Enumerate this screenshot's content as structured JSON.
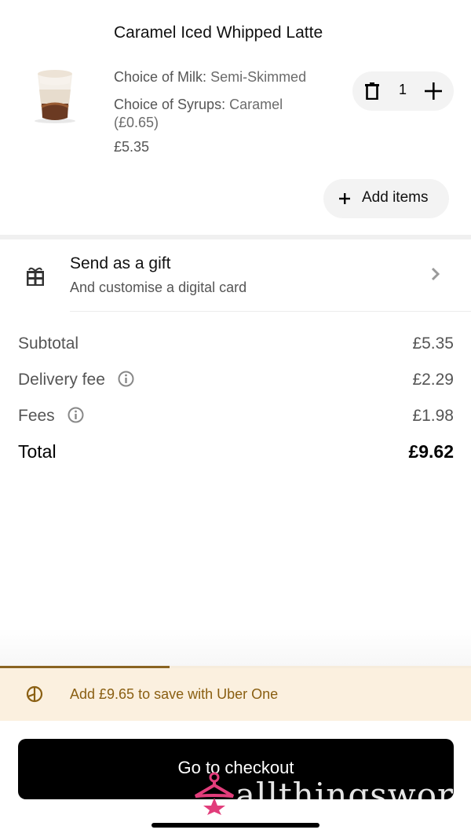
{
  "cart_item": {
    "name": "Caramel Iced Whipped Latte",
    "options": [
      {
        "label": "Choice of Milk:",
        "value": "Semi-Skimmed"
      },
      {
        "label": "Choice of Syrups:",
        "value": "Caramel (£0.65)"
      }
    ],
    "price": "£5.35",
    "quantity": "1"
  },
  "add_items_label": "Add items",
  "gift": {
    "title": "Send as a gift",
    "subtitle": "And customise a digital card"
  },
  "summary": {
    "subtotal_label": "Subtotal",
    "subtotal_value": "£5.35",
    "delivery_label": "Delivery fee",
    "delivery_value": "£2.29",
    "fees_label": "Fees",
    "fees_value": "£1.98",
    "total_label": "Total",
    "total_value": "£9.62"
  },
  "uber_one": {
    "text": "Add £9.65 to save with Uber One",
    "progress": 0.36,
    "accent": "#8a5f12"
  },
  "checkout_label": "Go to checkout",
  "watermark_text": "allthingsworn",
  "icons": [
    "latte-thumbnail",
    "trash-icon",
    "plus-icon",
    "gift-icon",
    "chevron-right-icon",
    "info-icon",
    "uber-one-icon",
    "hanger-logo"
  ]
}
